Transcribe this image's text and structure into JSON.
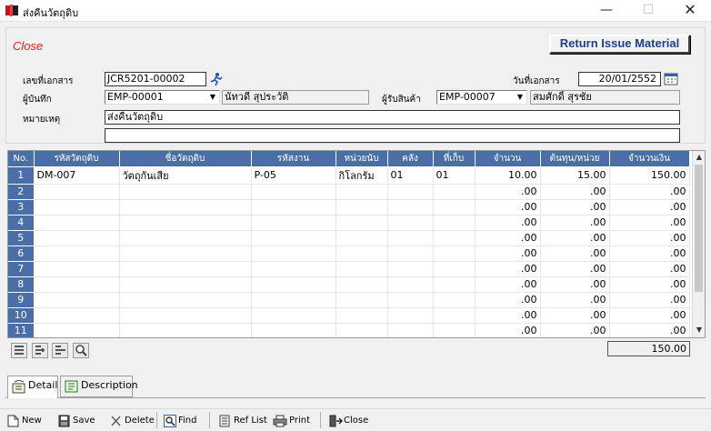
{
  "window": {
    "title": "ส่งคืนวัตถุดิบ",
    "minimize": "—",
    "maximize": "☐",
    "close": "✕"
  },
  "header": {
    "close_link": "Close",
    "title_button": "Return Issue Material",
    "doc_no_label": "เลขที่เอกสาร",
    "doc_no_value": "JCR5201-00002",
    "doc_date_label": "วันที่เอกสาร",
    "doc_date_value": "20/01/2552",
    "recorder_label": "ผู้บันทึก",
    "recorder_code": "EMP-00001",
    "recorder_name": "นัทวดี สุประวัติ",
    "receiver_label": "ผู้รับสินค้า",
    "receiver_code": "EMP-00007",
    "receiver_name": "สมศักดิ์  สุรชัย",
    "remark_label": "หมายเหตุ",
    "remark_line1": "ส่งคืนวัตถุดิบ",
    "remark_line2": ""
  },
  "grid": {
    "columns": [
      "No.",
      "รหัสวัตถุดิบ",
      "ชื่อวัตถุดิบ",
      "รหัสงาน",
      "หน่วยนับ",
      "คลัง",
      "ที่เก็บ",
      "จำนวน",
      "ต้นทุน/หน่วย",
      "จำนวนเงิน"
    ],
    "rows": [
      {
        "no": "1",
        "code": "DM-007",
        "name": "วัตถุกันเสีย",
        "job": "P-05",
        "unit": "กิโลกรัม",
        "wh": "01",
        "loc": "01",
        "qty": "10.00",
        "cost": "15.00",
        "amount": "150.00"
      },
      {
        "no": "2",
        "code": "",
        "name": "",
        "job": "",
        "unit": "",
        "wh": "",
        "loc": "",
        "qty": ".00",
        "cost": ".00",
        "amount": ".00"
      },
      {
        "no": "3",
        "code": "",
        "name": "",
        "job": "",
        "unit": "",
        "wh": "",
        "loc": "",
        "qty": ".00",
        "cost": ".00",
        "amount": ".00"
      },
      {
        "no": "4",
        "code": "",
        "name": "",
        "job": "",
        "unit": "",
        "wh": "",
        "loc": "",
        "qty": ".00",
        "cost": ".00",
        "amount": ".00"
      },
      {
        "no": "5",
        "code": "",
        "name": "",
        "job": "",
        "unit": "",
        "wh": "",
        "loc": "",
        "qty": ".00",
        "cost": ".00",
        "amount": ".00"
      },
      {
        "no": "6",
        "code": "",
        "name": "",
        "job": "",
        "unit": "",
        "wh": "",
        "loc": "",
        "qty": ".00",
        "cost": ".00",
        "amount": ".00"
      },
      {
        "no": "7",
        "code": "",
        "name": "",
        "job": "",
        "unit": "",
        "wh": "",
        "loc": "",
        "qty": ".00",
        "cost": ".00",
        "amount": ".00"
      },
      {
        "no": "8",
        "code": "",
        "name": "",
        "job": "",
        "unit": "",
        "wh": "",
        "loc": "",
        "qty": ".00",
        "cost": ".00",
        "amount": ".00"
      },
      {
        "no": "9",
        "code": "",
        "name": "",
        "job": "",
        "unit": "",
        "wh": "",
        "loc": "",
        "qty": ".00",
        "cost": ".00",
        "amount": ".00"
      },
      {
        "no": "10",
        "code": "",
        "name": "",
        "job": "",
        "unit": "",
        "wh": "",
        "loc": "",
        "qty": ".00",
        "cost": ".00",
        "amount": ".00"
      },
      {
        "no": "11",
        "code": "",
        "name": "",
        "job": "",
        "unit": "",
        "wh": "",
        "loc": "",
        "qty": ".00",
        "cost": ".00",
        "amount": ".00"
      }
    ],
    "total": "150.00"
  },
  "tabs": {
    "detail": "Detail",
    "description": "Description"
  },
  "toolbar": {
    "new": "New",
    "save": "Save",
    "delete": "Delete",
    "find": "Find",
    "ref_list": "Ref List",
    "print": "Print",
    "close": "Close"
  },
  "colors": {
    "grid_header": "#4a6ea8",
    "close_link": "#e02020",
    "title_button_text": "#1c3f8c"
  }
}
